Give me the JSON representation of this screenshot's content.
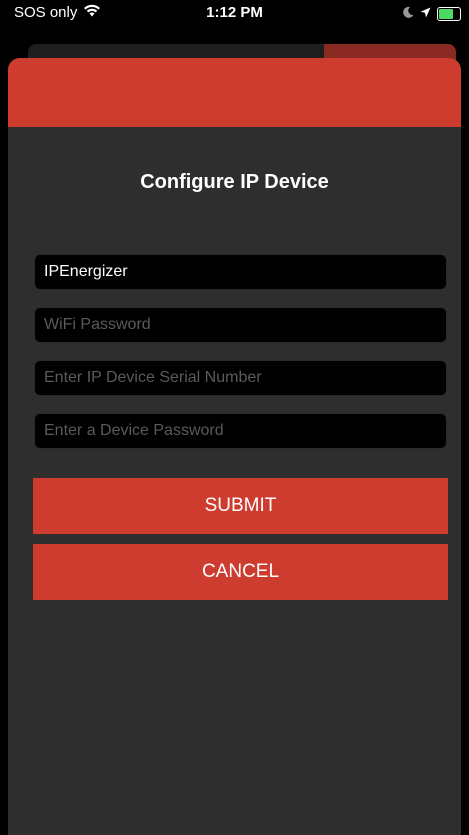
{
  "status_bar": {
    "carrier": "SOS only",
    "time": "1:12 PM",
    "wifi_icon": "wifi-icon",
    "moon_icon": "moon-icon",
    "location_icon": "location-arrow-icon",
    "battery_icon": "battery-charging-icon"
  },
  "dialog": {
    "title": "Configure IP Device",
    "fields": {
      "ssid_value": "IPEnergizer",
      "wifi_password_placeholder": "WiFi Password",
      "serial_placeholder": "Enter IP Device Serial Number",
      "device_password_placeholder": "Enter a Device Password"
    },
    "submit_label": "SUBMIT",
    "cancel_label": "CANCEL"
  },
  "colors": {
    "accent": "#cd3c2f",
    "sheet_background": "#2e2e2e",
    "field_background": "#000000"
  }
}
